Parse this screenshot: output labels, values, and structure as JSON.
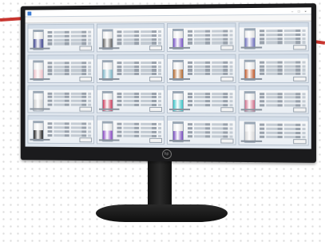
{
  "window": {
    "title": "",
    "menu": []
  },
  "colors": {
    "accent_red": "#c8352f",
    "bezel": "#1b1b1d",
    "card_border": "#b7c2cf"
  },
  "cards": [
    {
      "fill": "#3a3f8f"
    },
    {
      "fill": "#5f5f5f"
    },
    {
      "fill": "#7b55c9"
    },
    {
      "fill": "#6f6fbf"
    },
    {
      "fill": "#f0c0c8"
    },
    {
      "fill": "#7fb8c8"
    },
    {
      "fill": "#b66b2e"
    },
    {
      "fill": "#c45a2a"
    },
    {
      "fill": "#d0d0d0"
    },
    {
      "fill": "#d03a5a"
    },
    {
      "fill": "#3cc7c9"
    },
    {
      "fill": "#d36f8b"
    },
    {
      "fill": "#1a1a1a"
    },
    {
      "fill": "#8a45c4"
    },
    {
      "fill": "#7a4cc0"
    },
    {
      "fill": "#d8d8d8"
    }
  ]
}
